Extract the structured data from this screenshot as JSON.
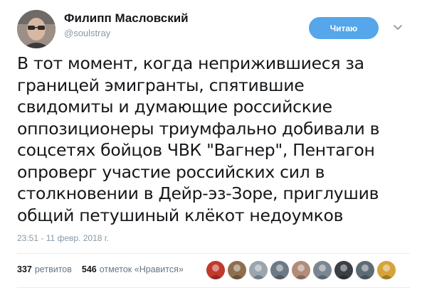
{
  "author": {
    "name": "Филипп Масловский",
    "handle": "@soulstray",
    "avatar_icon": "profile-photo"
  },
  "follow_button": {
    "label": "Читаю",
    "color": "#55a6ea"
  },
  "tweet": {
    "lines": [
      "В тот момент, когда неприжившиеся за",
      "границей эмигранты, спятившие",
      "свидомиты и думающие российские",
      "оппозиционеры триумфально добивали в",
      "соцсетях бойцов ЧВК \"Вагнер\", Пентагон",
      "опроверг участие российских сил в",
      "столкновении в Дейр-эз-Зоре, приглушив",
      "общий петушиный клёкот недоумков"
    ],
    "timestamp": "23:51 - 11 февр. 2018 г."
  },
  "stats": {
    "retweets_count": "337",
    "retweets_label": "ретвитов",
    "likes_count": "546",
    "likes_label": "отметок «Нравится»"
  },
  "likers": [
    {
      "name": "liker-avatar-1",
      "color": "#c0392b"
    },
    {
      "name": "liker-avatar-2",
      "color": "#8e6e4e"
    },
    {
      "name": "liker-avatar-3",
      "color": "#9aa5ad"
    },
    {
      "name": "liker-avatar-4",
      "color": "#6d7a85"
    },
    {
      "name": "liker-avatar-5",
      "color": "#b08c7a"
    },
    {
      "name": "liker-avatar-6",
      "color": "#7a8690"
    },
    {
      "name": "liker-avatar-7",
      "color": "#3a3f44"
    },
    {
      "name": "liker-avatar-8",
      "color": "#5f6b74"
    },
    {
      "name": "liker-avatar-9",
      "color": "#d4a33a"
    }
  ]
}
